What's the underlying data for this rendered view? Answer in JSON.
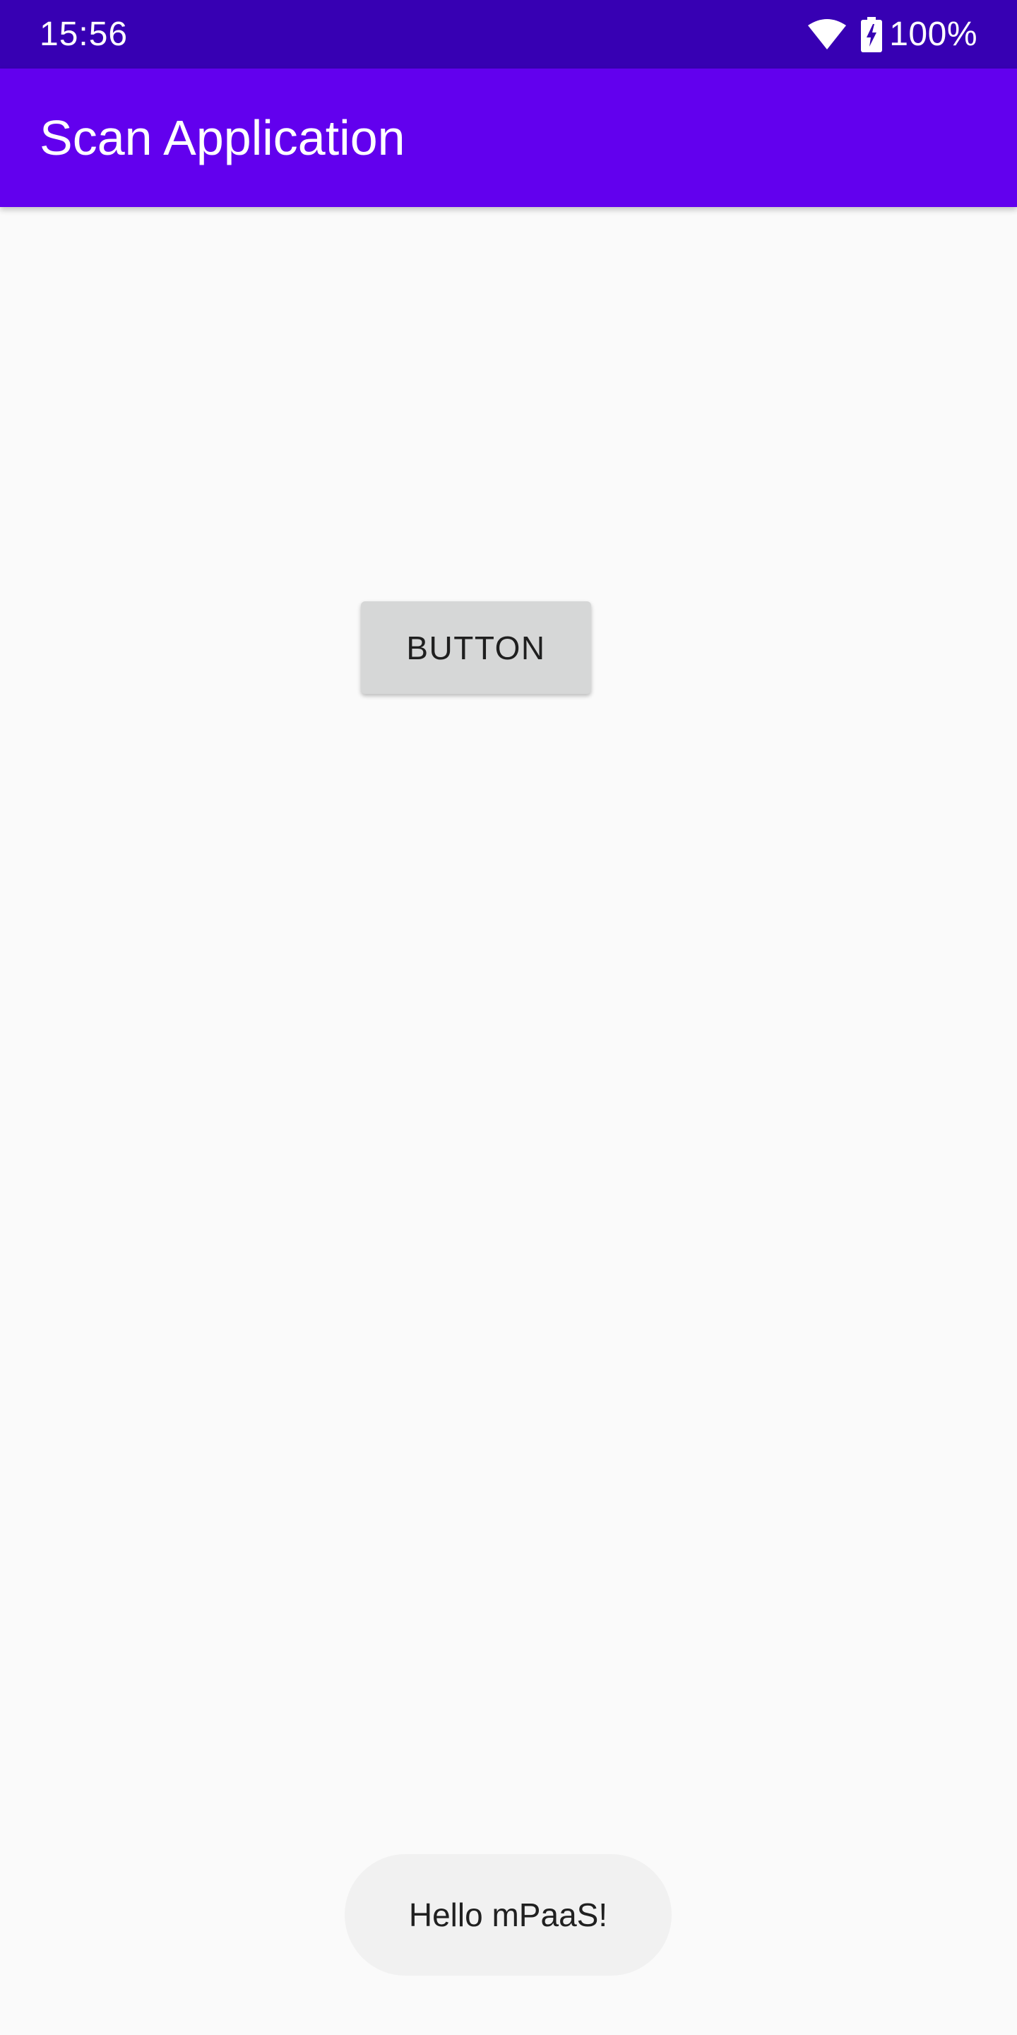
{
  "status_bar": {
    "time": "15:56",
    "battery": "100%",
    "icons": [
      "wifi-icon",
      "battery-charging-icon"
    ],
    "background_color": "#3700B3"
  },
  "app_bar": {
    "title": "Scan Application",
    "background_color": "#6200EE"
  },
  "main": {
    "button_label": "BUTTON"
  },
  "toast": {
    "message": "Hello mPaaS!"
  }
}
